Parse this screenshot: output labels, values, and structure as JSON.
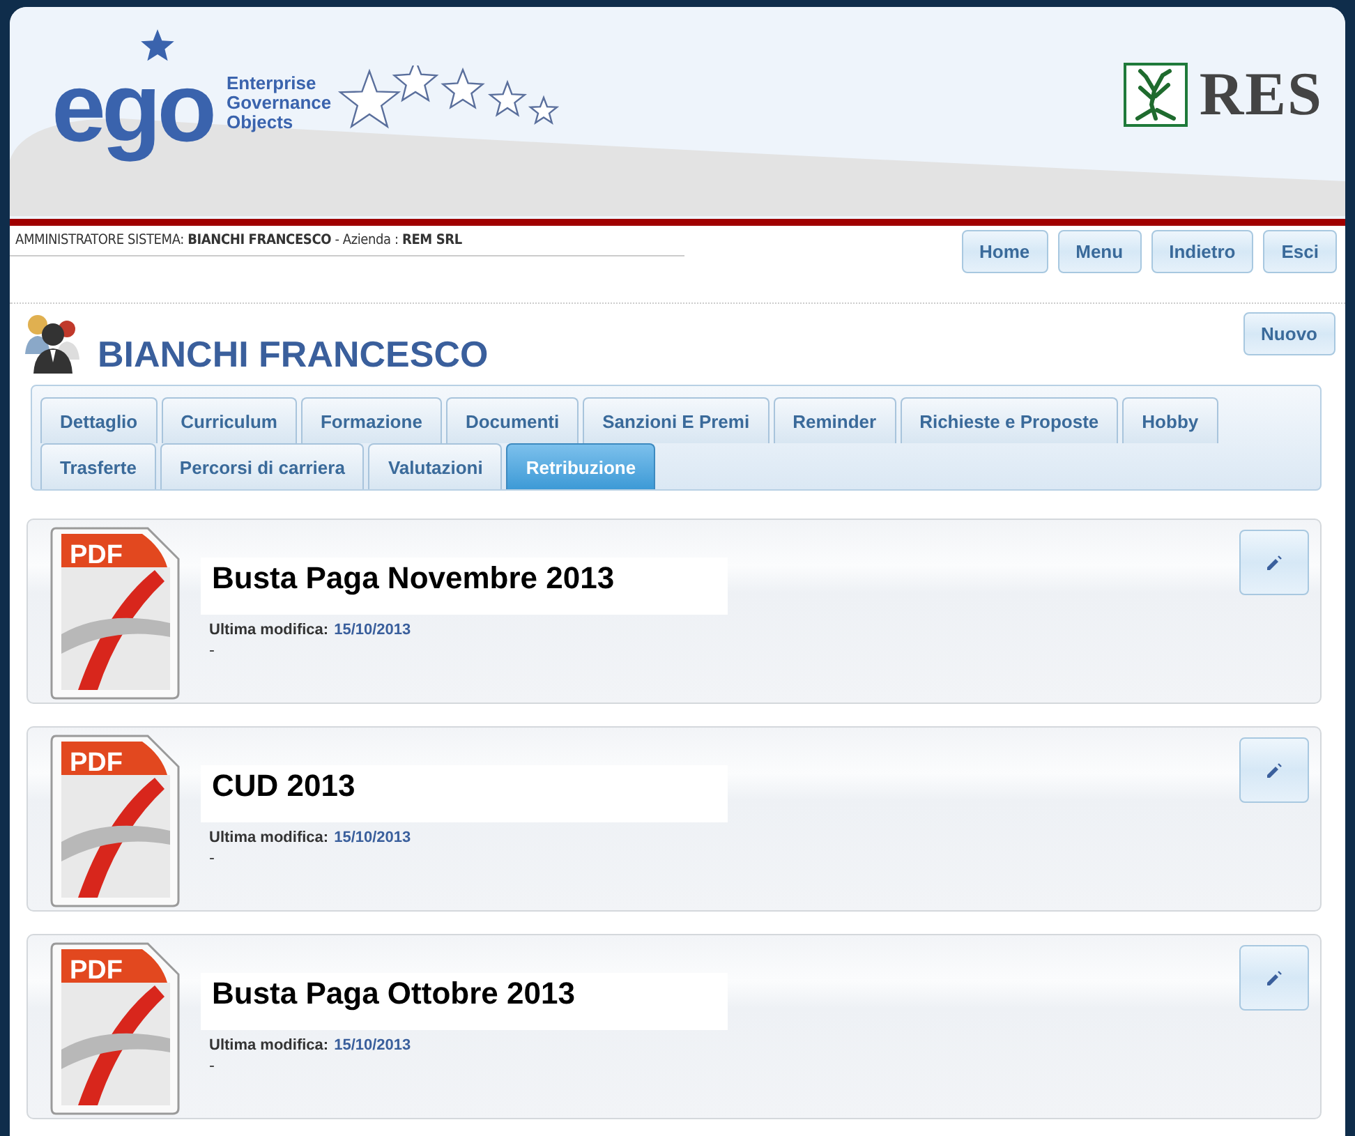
{
  "header": {
    "logo": {
      "mark": "ego",
      "tagline": [
        "Enterprise",
        "Governance",
        "Objects"
      ]
    },
    "company_logo": "RES"
  },
  "user_bar": {
    "text": "AMMINISTRATORE SISTEMA: **BIANCHI FRANCESCO** - Azienda : **REM SRL**"
  },
  "nav_buttons": [
    "Home",
    "Menu",
    "Indietro",
    "Esci"
  ],
  "person": {
    "name": "BIANCHI FRANCESCO"
  },
  "new_button": "Nuovo",
  "tab_rows": [
    [
      {
        "label": "Dettaglio",
        "selected": false
      },
      {
        "label": "Curriculum",
        "selected": false
      },
      {
        "label": "Formazione",
        "selected": false
      },
      {
        "label": "Documenti",
        "selected": false
      },
      {
        "label": "Sanzioni E Premi",
        "selected": false
      },
      {
        "label": "Reminder",
        "selected": false
      },
      {
        "label": "Richieste e Proposte",
        "selected": false
      },
      {
        "label": "Hobby",
        "selected": false
      }
    ],
    [
      {
        "label": "Trasferte",
        "selected": false
      },
      {
        "label": "Percorsi di carriera",
        "selected": false
      },
      {
        "label": "Valutazioni",
        "selected": false
      },
      {
        "label": "Retribuzione",
        "selected": true
      }
    ]
  ],
  "documents": [
    {
      "badge": "PDF",
      "title": "Busta Paga Novembre 2013",
      "modified_label": "Ultima modifica:",
      "modified_date": "15/10/2013",
      "note": "-"
    },
    {
      "badge": "PDF",
      "title": "CUD 2013",
      "modified_label": "Ultima modifica:",
      "modified_date": "15/10/2013",
      "note": "-"
    },
    {
      "badge": "PDF",
      "title": "Busta Paga Ottobre 2013",
      "modified_label": "Ultima modifica:",
      "modified_date": "15/10/2013",
      "note": "-"
    }
  ]
}
